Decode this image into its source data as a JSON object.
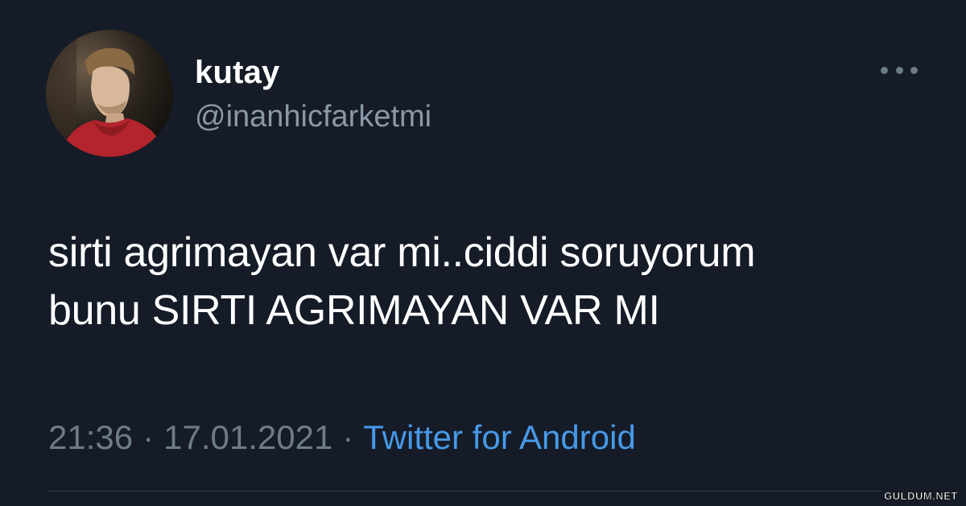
{
  "tweet": {
    "display_name": "kutay",
    "handle": "@inanhicfarketmi",
    "text_lines": [
      "sirti agrimayan var mi..ciddi soruyorum",
      "bunu SIRTI AGRIMAYAN VAR MI"
    ],
    "time": "21:36",
    "date": "17.01.2021",
    "separator": "·",
    "source": "Twitter for Android",
    "avatar_icon": "profile-photo",
    "more_icon": "more-horizontal-icon"
  },
  "watermark": {
    "text": "GULDUM.NET"
  },
  "colors": {
    "background": "#151c28",
    "primary_text": "#ffffff",
    "secondary_text": "#8b98a5",
    "link": "#4799e8"
  }
}
